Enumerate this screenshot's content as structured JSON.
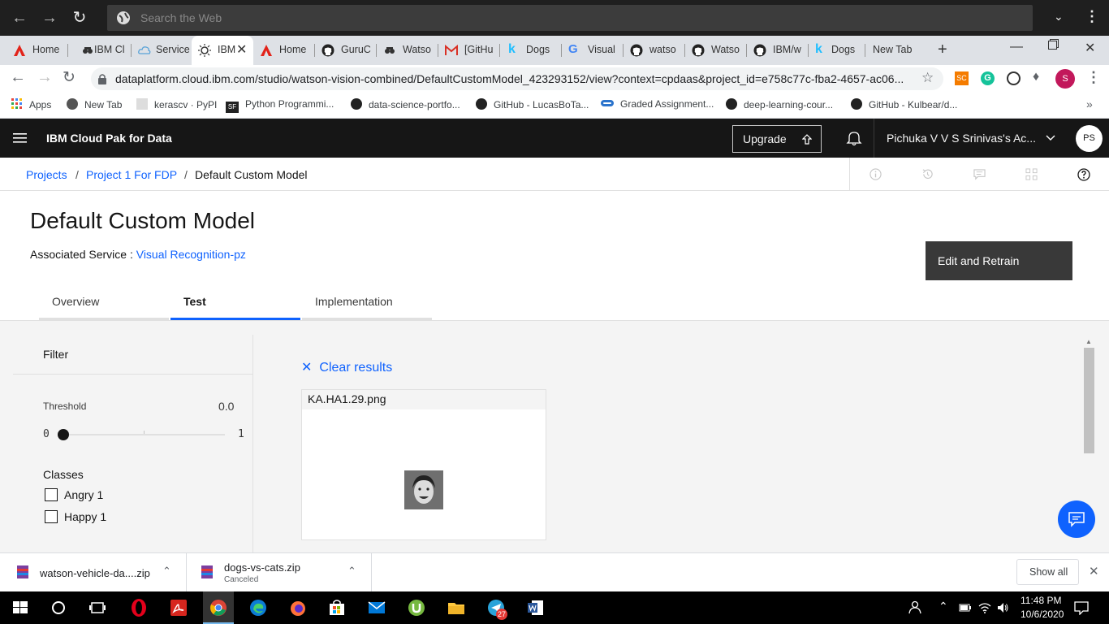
{
  "outer_browser": {
    "search_placeholder": "Search the Web"
  },
  "tabs": [
    {
      "label": "Home",
      "icon": "adobe-icon"
    },
    {
      "label": "IBM Cl",
      "icon": "watson-icon"
    },
    {
      "label": "Service",
      "icon": "cloud-icon"
    },
    {
      "label": "IBM",
      "icon": "bulb-icon",
      "active": true
    },
    {
      "label": "Home",
      "icon": "adobe-icon"
    },
    {
      "label": "GuruC",
      "icon": "github-icon"
    },
    {
      "label": "Watso",
      "icon": "watson-icon"
    },
    {
      "label": "[GitHu",
      "icon": "gmail-icon"
    },
    {
      "label": "Dogs",
      "icon": "kaggle-icon"
    },
    {
      "label": "Visual",
      "icon": "google-icon"
    },
    {
      "label": "watso",
      "icon": "github-icon"
    },
    {
      "label": "Watso",
      "icon": "github-icon"
    },
    {
      "label": "IBM/w",
      "icon": "github-icon"
    },
    {
      "label": "Dogs",
      "icon": "kaggle-icon"
    },
    {
      "label": "New Tab",
      "icon": ""
    }
  ],
  "address_bar": {
    "url": "dataplatform.cloud.ibm.com/studio/watson-vision-combined/DefaultCustomModel_423293152/view?context=cpdaas&project_id=e758c77c-fba2-4657-ac06...",
    "profile_initial": "S",
    "ext_sc": "SC"
  },
  "bookmarks": [
    {
      "label": "Apps"
    },
    {
      "label": "New Tab"
    },
    {
      "label": "kerascv · PyPI"
    },
    {
      "label": "Python Programmi..."
    },
    {
      "label": "data-science-portfo..."
    },
    {
      "label": "GitHub - LucasBoTa..."
    },
    {
      "label": "Graded Assignment..."
    },
    {
      "label": "deep-learning-cour..."
    },
    {
      "label": "GitHub - Kulbear/d..."
    }
  ],
  "ibm_header": {
    "title": "IBM Cloud Pak for Data",
    "upgrade_label": "Upgrade",
    "account": "Pichuka V V S Srinivas's Ac...",
    "avatar": "PS"
  },
  "breadcrumb": {
    "projects": "Projects",
    "project": "Project 1 For FDP",
    "current": "Default Custom Model",
    "sep": "/"
  },
  "page": {
    "title": "Default Custom Model",
    "assoc_label": "Associated Service : ",
    "assoc_link": "Visual Recognition-pz",
    "edit_button": "Edit and Retrain",
    "tabs": [
      "Overview",
      "Test",
      "Implementation"
    ],
    "selected_tab": "Test"
  },
  "filter": {
    "title": "Filter",
    "threshold_label": "Threshold",
    "threshold_value": "0.0",
    "slider_min": "0",
    "slider_max": "1",
    "slider_level": 0,
    "classes_title": "Classes",
    "classes": [
      "Angry 1",
      "Happy 1"
    ]
  },
  "results": {
    "clear_label": "Clear results",
    "card_filename": "KA.HA1.29.png"
  },
  "downloads": {
    "items": [
      {
        "name": "watson-vehicle-da....zip",
        "status": ""
      },
      {
        "name": "dogs-vs-cats.zip",
        "status": "Canceled"
      }
    ],
    "show_all": "Show all"
  },
  "taskbar": {
    "time": "11:48 PM",
    "date": "10/6/2020",
    "telegram_badge": "27"
  },
  "colors": {
    "ibm_blue": "#0f62fe",
    "header_dark": "#161616",
    "edit_button": "#393939"
  }
}
